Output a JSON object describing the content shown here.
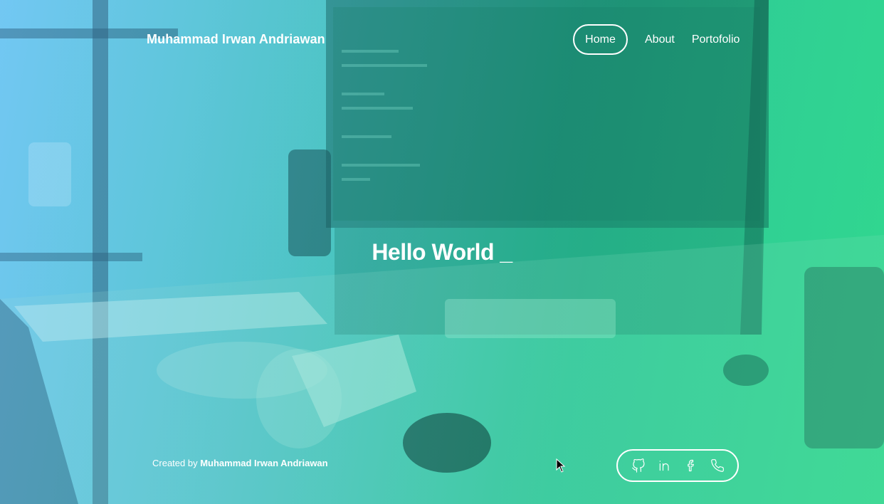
{
  "header": {
    "brand": "Muhammad Irwan Andriawan",
    "nav": [
      {
        "label": "Home",
        "active": true
      },
      {
        "label": "About",
        "active": false
      },
      {
        "label": "Portofolio",
        "active": false
      }
    ]
  },
  "hero": {
    "headline": "Hello World _"
  },
  "footer": {
    "credit_prefix": "Created by",
    "credit_name": "Muhammad Irwan Andriawan",
    "social_icons": [
      "github-icon",
      "linkedin-icon",
      "facebook-icon",
      "phone-icon"
    ]
  },
  "colors": {
    "gradient_start": "#6fc7f2",
    "gradient_end": "#31d690",
    "text": "#ffffff"
  }
}
